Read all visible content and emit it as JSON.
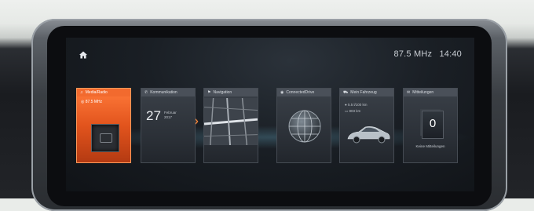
{
  "status": {
    "frequency": "87.5 MHz",
    "time": "14:40"
  },
  "tiles": [
    {
      "title": "Media/Radio",
      "subtitle": "87.5 MHz"
    },
    {
      "title": "Kommunikation",
      "day": "27",
      "month": "Februar",
      "year": "2017"
    },
    {
      "title": "Navigation"
    },
    {
      "title": "ConnectedDrive"
    },
    {
      "title": "Mein Fahrzeug",
      "line1": "5.5 l/100 km",
      "line2": "803 km"
    },
    {
      "title": "Mitteilungen",
      "count": "0",
      "footer": "Keine Mitteilungen"
    }
  ],
  "colors": {
    "accent": "#e2541d",
    "text": "#c9ced4"
  }
}
